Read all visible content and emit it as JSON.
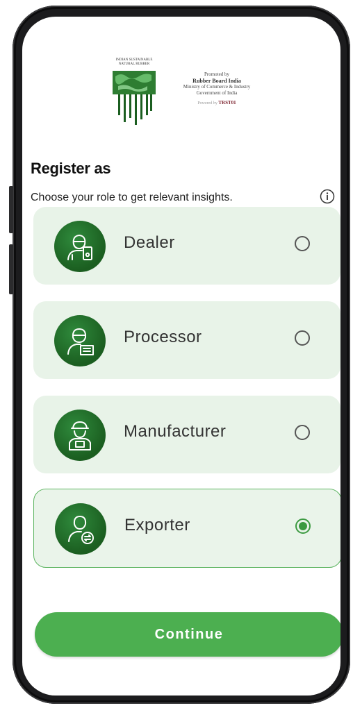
{
  "logo": {
    "line1": "INDIAN SUSTAINABLE",
    "line2": "NATURAL RUBBER"
  },
  "promo": {
    "line1": "Promoted by",
    "line2": "Rubber Board India",
    "line3": "Ministry of Commerce & Industry",
    "line4": "Government of India",
    "powered_prefix": "Powered by",
    "powered_brand": "TRST01"
  },
  "header": {
    "title": "Register as",
    "subtitle": "Choose your role to get relevant insights."
  },
  "roles": [
    {
      "label": "Dealer",
      "icon": "dealer-icon",
      "selected": false
    },
    {
      "label": "Processor",
      "icon": "processor-icon",
      "selected": false
    },
    {
      "label": "Manufacturer",
      "icon": "manufacturer-icon",
      "selected": false
    },
    {
      "label": "Exporter",
      "icon": "exporter-icon",
      "selected": true
    }
  ],
  "continue_label": "Continue",
  "colors": {
    "accent": "#4caf50",
    "card_bg": "#e8f3e8",
    "avatar": "#1b5e20"
  }
}
